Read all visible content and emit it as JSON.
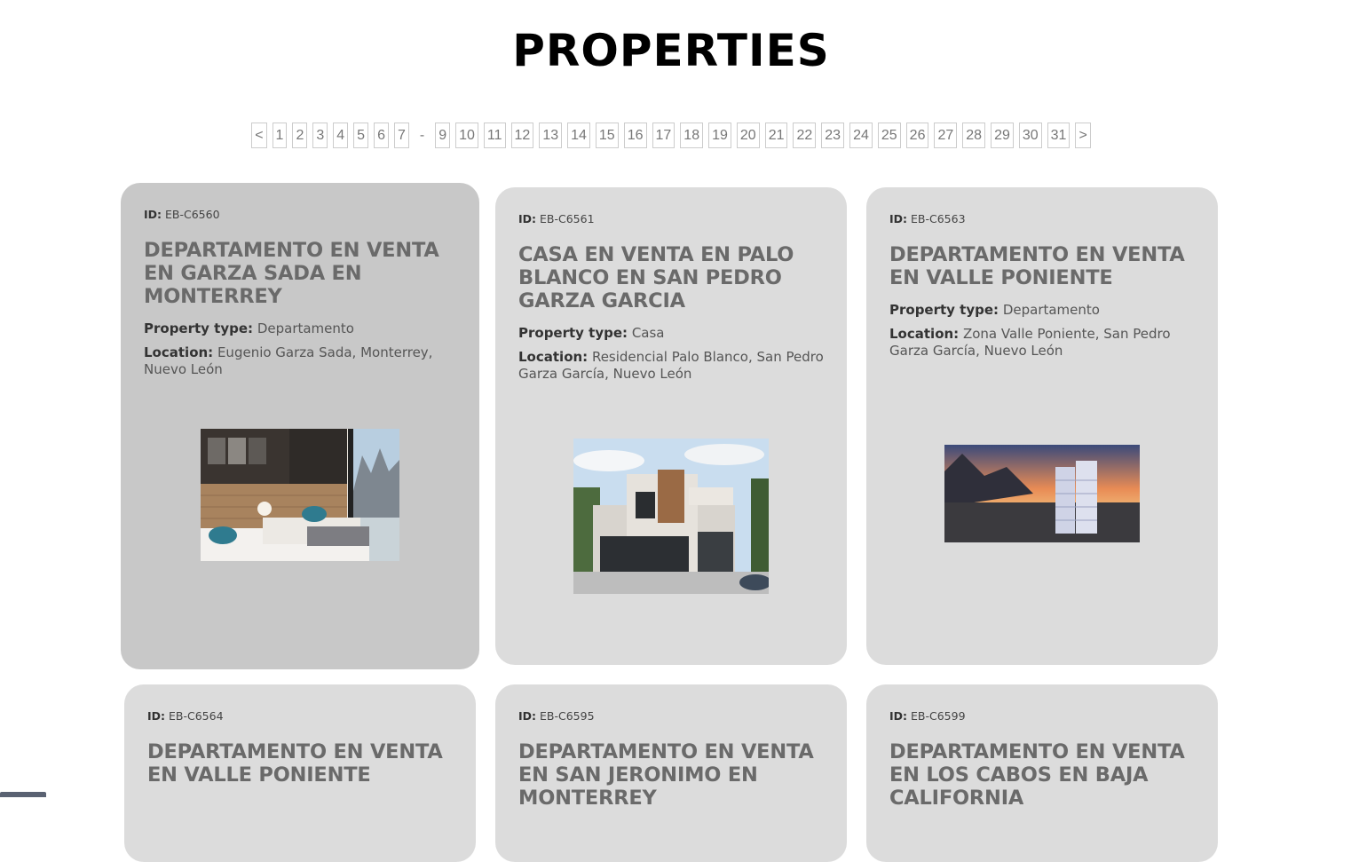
{
  "page_title": "PROPERTIES",
  "pagination": {
    "prev": "<",
    "pages_a": [
      "1",
      "2",
      "3",
      "4",
      "5",
      "6",
      "7"
    ],
    "sep": "-",
    "pages_b": [
      "9",
      "10",
      "11",
      "12",
      "13",
      "14",
      "15",
      "16",
      "17",
      "18",
      "19",
      "20",
      "21",
      "22",
      "23",
      "24",
      "25",
      "26",
      "27",
      "28",
      "29",
      "30",
      "31"
    ],
    "next": ">"
  },
  "labels": {
    "id": "ID:",
    "property_type": "Property type:",
    "location": "Location:"
  },
  "cards": [
    {
      "id": "EB-C6560",
      "title": "DEPARTAMENTO EN VENTA EN GARZA SADA EN MONTERREY",
      "type": "Departamento",
      "location": "Eugenio Garza Sada, Monterrey, Nuevo León"
    },
    {
      "id": "EB-C6561",
      "title": "CASA EN VENTA EN PALO BLANCO EN SAN PEDRO GARZA GARCIA",
      "type": "Casa",
      "location": "Residencial Palo Blanco, San Pedro Garza García, Nuevo León"
    },
    {
      "id": "EB-C6563",
      "title": "DEPARTAMENTO EN VENTA EN VALLE PONIENTE",
      "type": "Departamento",
      "location": "Zona Valle Poniente, San Pedro Garza García, Nuevo León"
    },
    {
      "id": "EB-C6564",
      "title": "DEPARTAMENTO EN VENTA EN VALLE PONIENTE"
    },
    {
      "id": "EB-C6595",
      "title": "DEPARTAMENTO EN VENTA EN SAN JERONIMO EN MONTERREY"
    },
    {
      "id": "EB-C6599",
      "title": "DEPARTAMENTO EN VENTA EN LOS CABOS EN BAJA CALIFORNIA"
    }
  ]
}
